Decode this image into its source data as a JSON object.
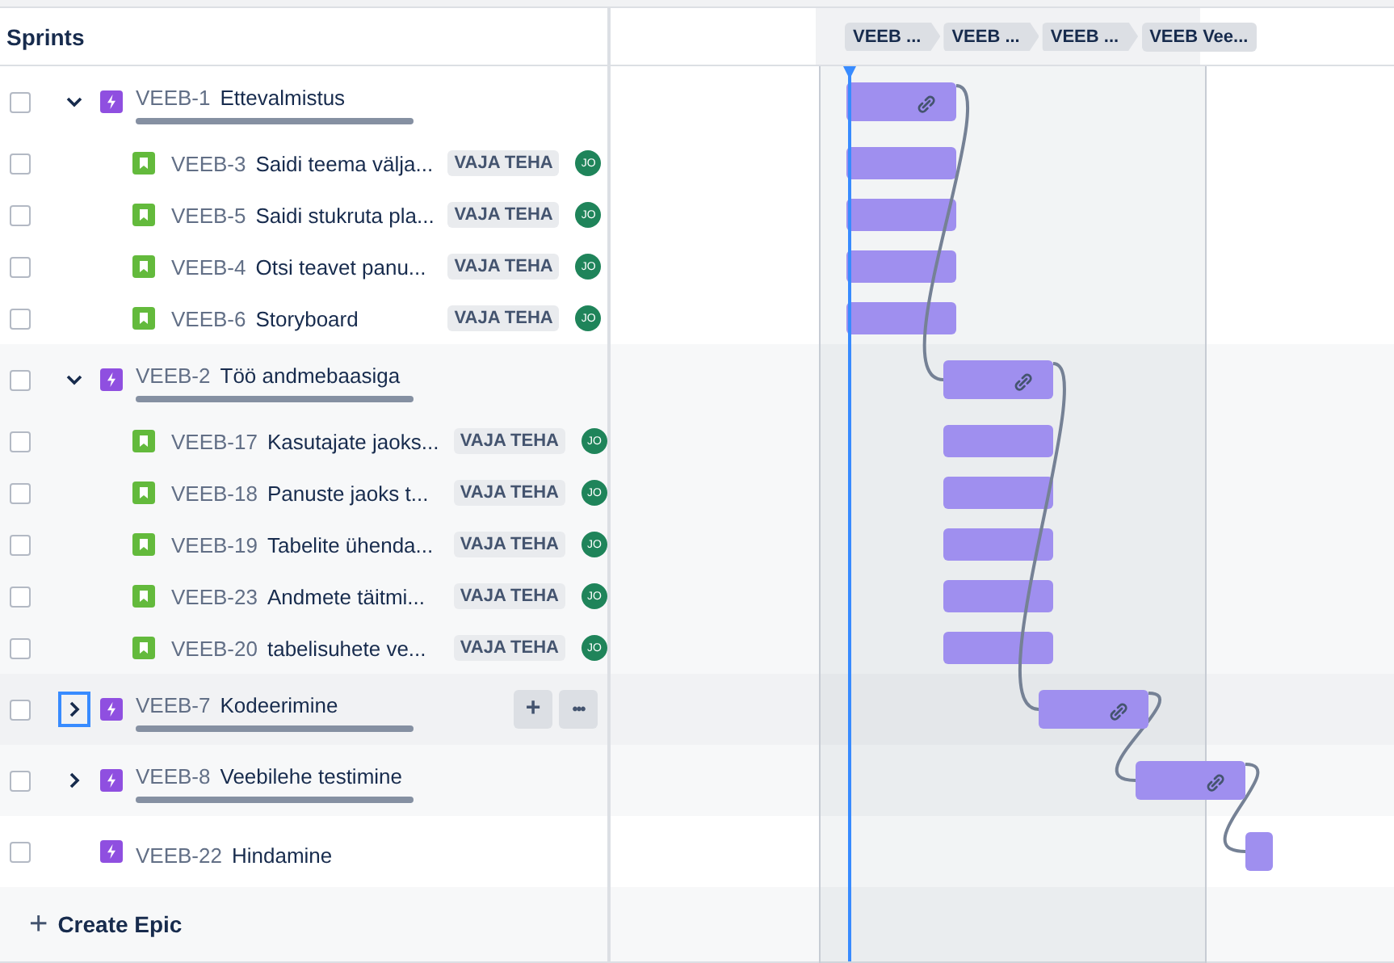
{
  "header": {
    "title": "Sprints",
    "sprints": [
      "VEEB ...",
      "VEEB ...",
      "VEEB ...",
      "VEEB Vee..."
    ]
  },
  "epics": [
    {
      "key": "VEEB-1",
      "title": "Ettevalmistus",
      "checked": false,
      "expanded": true,
      "chevron_focused": false,
      "hovered": false,
      "has_progress": true,
      "linked": true,
      "children": [
        {
          "key": "VEEB-3",
          "title": "Saidi teema välja...",
          "status": "VAJA TEHA",
          "assignee": "JO",
          "checked": false
        },
        {
          "key": "VEEB-5",
          "title": "Saidi stukruta pla...",
          "status": "VAJA TEHA",
          "assignee": "JO",
          "checked": false
        },
        {
          "key": "VEEB-4",
          "title": "Otsi teavet panu...",
          "status": "VAJA TEHA",
          "assignee": "JO",
          "checked": false
        },
        {
          "key": "VEEB-6",
          "title": "Storyboard",
          "status": "VAJA TEHA",
          "assignee": "JO",
          "checked": false
        }
      ]
    },
    {
      "key": "VEEB-2",
      "title": "Töö andmebaasiga",
      "checked": false,
      "expanded": true,
      "chevron_focused": false,
      "hovered": false,
      "has_progress": true,
      "linked": true,
      "children": [
        {
          "key": "VEEB-17",
          "title": "Kasutajate jaoks...",
          "status": "VAJA TEHA",
          "assignee": "JO",
          "checked": false
        },
        {
          "key": "VEEB-18",
          "title": "Panuste jaoks t...",
          "status": "VAJA TEHA",
          "assignee": "JO",
          "checked": false
        },
        {
          "key": "VEEB-19",
          "title": "Tabelite ühenda...",
          "status": "VAJA TEHA",
          "assignee": "JO",
          "checked": false
        },
        {
          "key": "VEEB-23",
          "title": "Andmete täitmi...",
          "status": "VAJA TEHA",
          "assignee": "JO",
          "checked": false
        },
        {
          "key": "VEEB-20",
          "title": "tabelisuhete ve...",
          "status": "VAJA TEHA",
          "assignee": "JO",
          "checked": false
        }
      ]
    },
    {
      "key": "VEEB-7",
      "title": "Kodeerimine",
      "checked": false,
      "expanded": false,
      "chevron_focused": true,
      "hovered": true,
      "has_progress": true,
      "linked": true,
      "actions": [
        "+",
        "•••"
      ]
    },
    {
      "key": "VEEB-8",
      "title": "Veebilehe testimine",
      "checked": false,
      "expanded": false,
      "chevron_focused": false,
      "hovered": false,
      "has_progress": true,
      "linked": true
    },
    {
      "key": "VEEB-22",
      "title": "Hindamine",
      "checked": false,
      "hovered": false,
      "has_progress": false,
      "linked": false
    }
  ],
  "create_button": {
    "icon": "+",
    "label": "Create Epic"
  }
}
